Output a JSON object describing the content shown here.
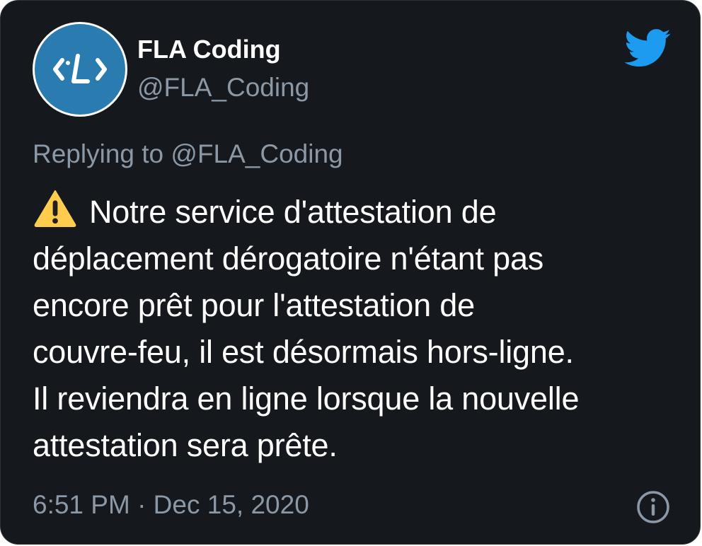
{
  "author": {
    "name": "FLA Coding",
    "handle": "@FLA_Coding",
    "avatar_icon": "fla-logo-icon",
    "avatar_bg": "#2a7cb0"
  },
  "reply": {
    "text": "Replying to @FLA_Coding"
  },
  "tweet": {
    "warning_icon": "warning-icon",
    "lines": [
      "Notre service d'attestation de",
      "déplacement dérogatoire n'étant pas",
      "encore prêt pour l'attestation de",
      "couvre-feu, il est désormais hors-ligne.",
      "Il reviendra en ligne lorsque la nouvelle",
      "attestation sera prête."
    ]
  },
  "meta": {
    "timestamp": "6:51 PM · Dec 15, 2020"
  },
  "icons": {
    "brand": "twitter-bird-icon",
    "info": "info-icon"
  },
  "colors": {
    "background": "#15181c",
    "text": "#ffffff",
    "muted": "#8b98a5",
    "twitter_blue": "#1d9bf0",
    "warning": "#ffcc4d"
  }
}
